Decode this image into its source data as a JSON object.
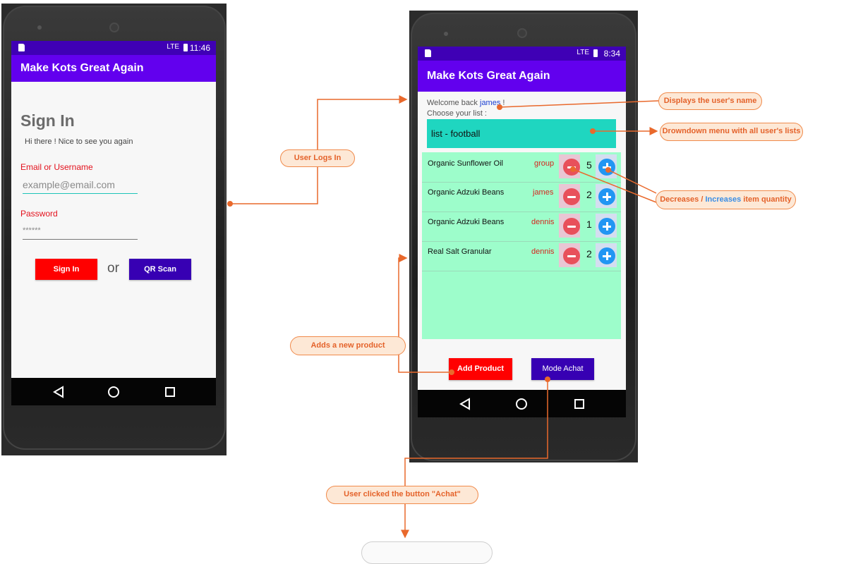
{
  "left_phone": {
    "status_time": "11:46",
    "status_signal": "LTE",
    "app_title": "Make Kots Great Again",
    "signin": {
      "heading": "Sign In",
      "subtitle": "Hi there ! Nice to see you again",
      "email_label": "Email or Username",
      "email_placeholder": "example@email.com",
      "password_label": "Password",
      "password_value": "******",
      "signin_button": "Sign In",
      "or_text": "or",
      "qr_button": "QR Scan"
    }
  },
  "right_phone": {
    "status_time": "8:34",
    "status_signal": "LTE",
    "app_title": "Make Kots Great Again",
    "welcome_prefix": "Welcome back",
    "welcome_user": "james",
    "welcome_suffix": " !",
    "choose_label": "Choose your list :",
    "selected_list": "list - football",
    "items": [
      {
        "name": "Organic Sunflower Oil",
        "owner": "group",
        "qty": "5"
      },
      {
        "name": "Organic Adzuki Beans",
        "owner": "james",
        "qty": "2"
      },
      {
        "name": "Organic Adzuki Beans",
        "owner": "dennis",
        "qty": "1"
      },
      {
        "name": "Real Salt Granular",
        "owner": "dennis",
        "qty": "2"
      }
    ],
    "add_product_button": "Add Product",
    "mode_achat_button": "Mode Achat"
  },
  "callouts": {
    "user_logs_in": "User Logs In",
    "displays_name": "Displays the user's name",
    "dropdown_menu": "Drowndown menu with all user's lists",
    "decreases": "Decreases",
    "slash": " / ",
    "increases": "Increases",
    "item_quantity": " item quantity",
    "adds_product": "Adds a new product",
    "user_clicked": "User clicked the button \"Achat\""
  },
  "colors": {
    "arrow": "#e9692c",
    "callout_fill": "#fde8d6",
    "app_bar": "#6200ee",
    "status_bar": "#3f00b5",
    "dropdown": "#1fd6c0",
    "list_bg": "#9dfdcb",
    "red_button": "#ff0000",
    "purple_button": "#3700b3"
  }
}
